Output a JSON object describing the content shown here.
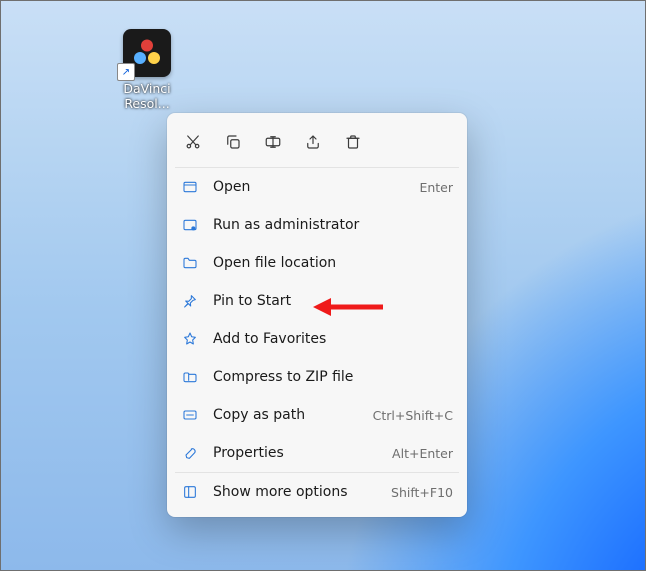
{
  "shortcut": {
    "label": "DaVinci Resol..."
  },
  "quick_actions": {
    "cut": "Cut",
    "copy": "Copy",
    "rename": "Rename",
    "share": "Share",
    "delete": "Delete"
  },
  "menu": {
    "open": {
      "label": "Open",
      "accel": "Enter"
    },
    "run_admin": {
      "label": "Run as administrator",
      "accel": ""
    },
    "open_location": {
      "label": "Open file location",
      "accel": ""
    },
    "pin_start": {
      "label": "Pin to Start",
      "accel": ""
    },
    "favorites": {
      "label": "Add to Favorites",
      "accel": ""
    },
    "compress": {
      "label": "Compress to ZIP file",
      "accel": ""
    },
    "copy_path": {
      "label": "Copy as path",
      "accel": "Ctrl+Shift+C"
    },
    "properties": {
      "label": "Properties",
      "accel": "Alt+Enter"
    },
    "more": {
      "label": "Show more options",
      "accel": "Shift+F10"
    }
  }
}
